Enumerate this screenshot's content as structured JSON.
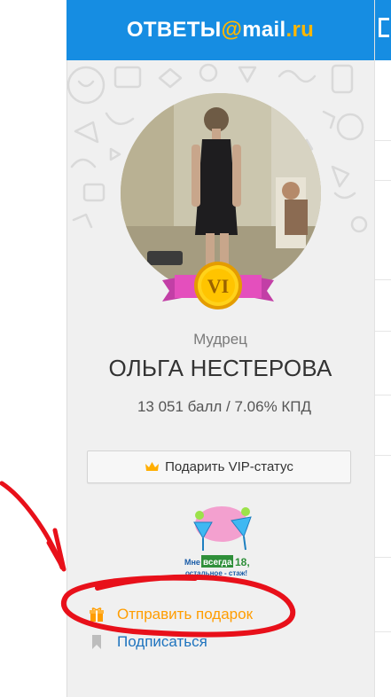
{
  "header": {
    "logo_part1": "ОТВЕТЫ",
    "logo_at": "@",
    "logo_part2": "mail",
    "logo_part3": ".ru",
    "color": "#168de2"
  },
  "profile": {
    "badge_text": "VI",
    "rank": "Мудрец",
    "name": "ОЛЬГА НЕСТЕРОВА",
    "stats": "13 051 балл / 7.06% КПД"
  },
  "vip_button": {
    "label": "Подарить VIP-статус",
    "icon": "crown-icon"
  },
  "sticker": {
    "line1": "Мне",
    "line2": "всегда",
    "line3": "18,",
    "line4": "остальное - стаж!"
  },
  "actions": [
    {
      "label": "Отправить подарок",
      "icon": "gift-icon",
      "color": "#ff9d00"
    },
    {
      "label": "Подписаться",
      "icon": "bookmark-icon",
      "color": "#1e73be"
    }
  ],
  "annotation": {
    "color": "#e8101a"
  }
}
